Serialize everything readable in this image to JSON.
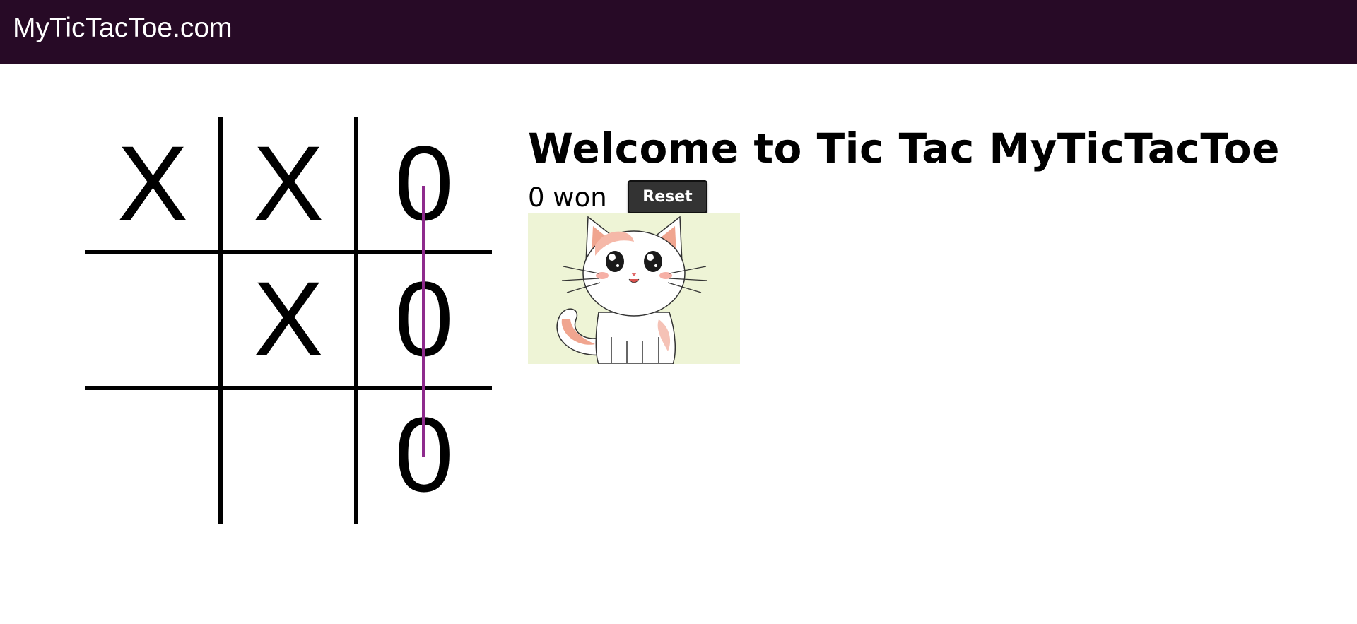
{
  "header": {
    "site_title": "MyTicTacToe.com",
    "background": "#270a26"
  },
  "board": {
    "cells": [
      "X",
      "X",
      "0",
      "",
      "X",
      "0",
      "",
      "",
      "0"
    ],
    "winning_line_color": "#8e2a8d",
    "winning_column": 2
  },
  "info": {
    "welcome": "Welcome to Tic Tac MyTicTacToe",
    "status": "0 won",
    "reset_label": "Reset"
  },
  "image": {
    "subject": "cartoon-white-kitten",
    "background": "#eef4d6"
  }
}
